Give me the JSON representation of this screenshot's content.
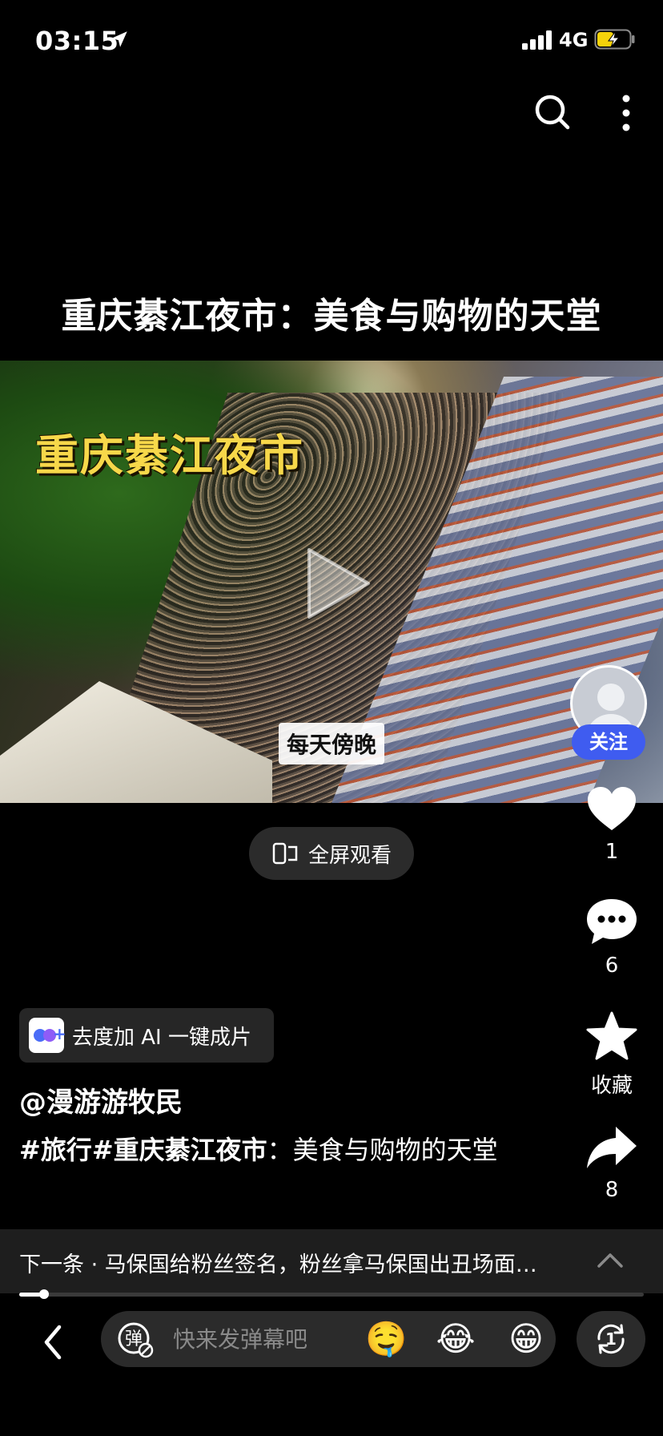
{
  "status_bar": {
    "time": "03:15",
    "network": "4G",
    "icons": [
      "location-arrow-icon",
      "signal-icon",
      "battery-charging-icon"
    ]
  },
  "header": {
    "icons": [
      "search-icon",
      "more-icon"
    ]
  },
  "video": {
    "title": "重庆綦江夜市：美食与购物的天堂",
    "overlay_title": "重庆綦江夜市",
    "overlay_caption": "每天傍晚",
    "fullscreen_label": "全屏观看"
  },
  "side_rail": {
    "follow_label": "关注",
    "like_count": "1",
    "comment_count": "6",
    "favorite_label": "收藏",
    "share_count": "8"
  },
  "ai_chip": {
    "label": "去度加 AI 一键成片"
  },
  "post": {
    "author": "@漫游游牧民",
    "tag1": "#旅行",
    "tag2": "#重庆綦江夜市",
    "text": "：美食与购物的天堂"
  },
  "next_bar": {
    "text": "下一条 · 马保国给粉丝签名，粉丝拿马保国出丑场面…"
  },
  "playback": {
    "progress_fraction": 0.04
  },
  "bottom_bar": {
    "danmaku_placeholder": "快来发弹幕吧",
    "danmaku_toggle_label": "弹",
    "emojis": [
      "🤤",
      "😂",
      "😁"
    ],
    "replay_label": "1"
  },
  "colors": {
    "background": "#000000",
    "accent": "#3f5cf0",
    "overlay_title": "#f7d84a"
  }
}
